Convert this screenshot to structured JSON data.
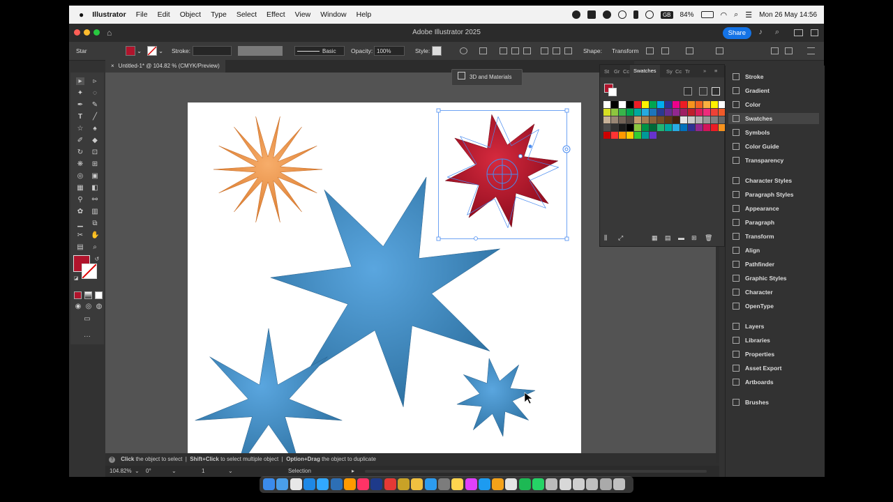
{
  "menubar": {
    "apple": "",
    "app_name": "Illustrator",
    "items": [
      "File",
      "Edit",
      "Object",
      "Type",
      "Select",
      "Effect",
      "View",
      "Window",
      "Help"
    ],
    "battery": "84%",
    "keyboard": "GB",
    "clock": "Mon 26 May  14:56"
  },
  "window": {
    "title": "Adobe Illustrator 2025",
    "share_label": "Share"
  },
  "controlbar": {
    "object_type": "Star",
    "fill_color": "#b0142c",
    "stroke_label": "Stroke:",
    "stroke_style": "Basic",
    "opacity_label": "Opacity:",
    "opacity_value": "100%",
    "style_label": "Style:",
    "shape_label": "Shape:",
    "transform_label": "Transform"
  },
  "document_tab": {
    "close_glyph": "×",
    "label": "Untitled-1* @ 104.82 % (CMYK/Preview)"
  },
  "popup_3d": {
    "label": "3D and Materials"
  },
  "swatches_panel": {
    "tabs": [
      "St",
      "Gr",
      "Cc",
      "Swatches",
      "Sy",
      "Cc",
      "Tr"
    ],
    "active_tab": "Swatches",
    "colors": [
      "#ffffff",
      "#000000",
      "#ffffff",
      "#000000",
      "#ed1c24",
      "#fff200",
      "#00a651",
      "#00aeef",
      "#2e3192",
      "#ec008c",
      "#ed1c24",
      "#f7941d",
      "#f26522",
      "#fbb040",
      "#fff200",
      "#ffffff",
      "#d7df23",
      "#8dc63f",
      "#39b54a",
      "#00a651",
      "#00a99d",
      "#27aae1",
      "#1c75bc",
      "#2b3990",
      "#662d91",
      "#92278f",
      "#9e1f63",
      "#be1e2d",
      "#da1c5c",
      "#ee2a7b",
      "#ef4136",
      "#f15a29",
      "#c7b299",
      "#998675",
      "#736357",
      "#534741",
      "#c69c6d",
      "#a67c52",
      "#8c6239",
      "#754c24",
      "#603813",
      "#42210b",
      "#e6e6e6",
      "#cccccc",
      "#b3b3b3",
      "#999999",
      "#808080",
      "#666666",
      "#4d4d4d",
      "#333333",
      "#1a1a1a",
      "#000000",
      "#8cc63f",
      "#009245",
      "#006837",
      "#22b573",
      "#00a99d",
      "#29abe2",
      "#0071bc",
      "#2e3192",
      "#93278f",
      "#d4145a",
      "#ed1c24",
      "#f7931e",
      "#cc0000",
      "#ff3333",
      "#ff9900",
      "#ffcc00",
      "#33cc33",
      "#009999",
      "#6633cc"
    ]
  },
  "dock_panels": [
    {
      "label": "Stroke",
      "icon": "stroke-icon"
    },
    {
      "label": "Gradient",
      "icon": "gradient-icon"
    },
    {
      "label": "Color",
      "icon": "color-icon"
    },
    {
      "label": "Swatches",
      "icon": "swatches-icon",
      "active": true
    },
    {
      "label": "Symbols",
      "icon": "symbols-icon"
    },
    {
      "label": "Color Guide",
      "icon": "color-guide-icon"
    },
    {
      "label": "Transparency",
      "icon": "transparency-icon"
    },
    {
      "label": "Character Styles",
      "icon": "character-styles-icon"
    },
    {
      "label": "Paragraph Styles",
      "icon": "paragraph-styles-icon"
    },
    {
      "label": "Appearance",
      "icon": "appearance-icon"
    },
    {
      "label": "Paragraph",
      "icon": "paragraph-icon"
    },
    {
      "label": "Transform",
      "icon": "transform-icon"
    },
    {
      "label": "Align",
      "icon": "align-icon"
    },
    {
      "label": "Pathfinder",
      "icon": "pathfinder-icon"
    },
    {
      "label": "Graphic Styles",
      "icon": "graphic-styles-icon"
    },
    {
      "label": "Character",
      "icon": "character-icon"
    },
    {
      "label": "OpenType",
      "icon": "opentype-icon"
    },
    {
      "label": "Layers",
      "icon": "layers-icon"
    },
    {
      "label": "Libraries",
      "icon": "libraries-icon"
    },
    {
      "label": "Properties",
      "icon": "properties-icon"
    },
    {
      "label": "Asset Export",
      "icon": "asset-export-icon"
    },
    {
      "label": "Artboards",
      "icon": "artboards-icon"
    },
    {
      "label": "Brushes",
      "icon": "brushes-icon"
    }
  ],
  "statusbar": {
    "hint1_key": "Click",
    "hint1_text": " the object to select  |  ",
    "hint2_key": "Shift+Click",
    "hint2_text": " to select multiple object  |  ",
    "hint3_key": "Option+Drag",
    "hint3_text": " the object to duplicate"
  },
  "bottombar": {
    "zoom": "104.82%",
    "rotation": "0°",
    "artboard_number": "1",
    "mode": "Selection"
  },
  "colors": {
    "star_orange": "#f0923a",
    "star_blue": "#3f8fcf",
    "star_red": "#c0142c",
    "selection_blue": "#4a8cf0"
  }
}
